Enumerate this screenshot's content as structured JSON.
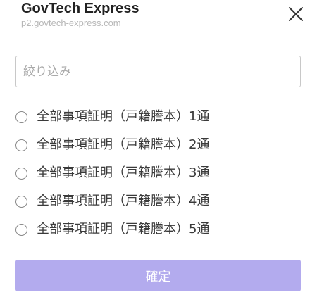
{
  "header": {
    "title": "GovTech Express",
    "subtitle": "p2.govtech-express.com",
    "close_icon": "close-icon"
  },
  "filter": {
    "placeholder": "絞り込み",
    "value": ""
  },
  "options": [
    {
      "label": "全部事項証明（戸籍謄本）1通",
      "selected": false
    },
    {
      "label": "全部事項証明（戸籍謄本）2通",
      "selected": false
    },
    {
      "label": "全部事項証明（戸籍謄本）3通",
      "selected": false
    },
    {
      "label": "全部事項証明（戸籍謄本）4通",
      "selected": false
    },
    {
      "label": "全部事項証明（戸籍謄本）5通",
      "selected": false
    }
  ],
  "confirm": {
    "label": "確定",
    "color": "#b3abee"
  }
}
